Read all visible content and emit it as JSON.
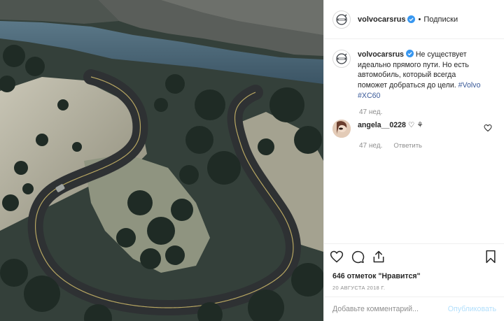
{
  "photo": {
    "alt_icon": "photo-image"
  },
  "header": {
    "username": "volvocarsrus",
    "follow_label": "Подписки",
    "separator": "•"
  },
  "caption": {
    "username": "volvocarsrus",
    "text": "Не существует идеально прямого пути. Но есть автомобиль, который всегда поможет добраться до цели.",
    "hashtags": [
      "#Volvo",
      "#XC60"
    ],
    "time": "47 нед."
  },
  "comment": {
    "username": "angela__0228",
    "text": "♡ ⚘",
    "time": "47 нед.",
    "reply_label": "Ответить"
  },
  "actions": {
    "likes": "646 отметок \"Нравится\"",
    "date": "20 АВГУСТА 2018 Г."
  },
  "add_comment": {
    "placeholder": "Добавьте комментарий...",
    "publish_label": "Опубликовать"
  },
  "colors": {
    "link": "#3a5a99",
    "verified": "#3897f0",
    "publish_disabled": "#b2dffc",
    "muted": "#8e8e8e"
  }
}
